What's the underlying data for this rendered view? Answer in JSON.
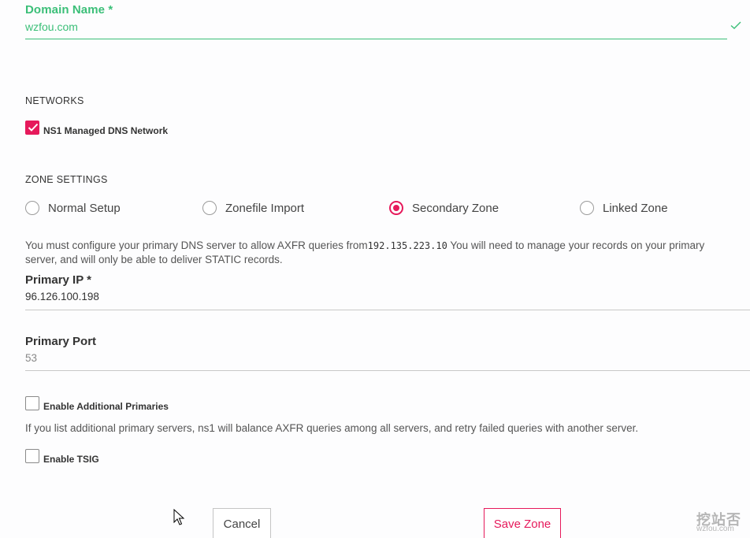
{
  "domain": {
    "label": "Domain Name *",
    "value": "wzfou.com"
  },
  "networks": {
    "heading": "NETWORKS",
    "ns1": {
      "label": "NS1 Managed DNS Network",
      "checked": true
    }
  },
  "zone_settings": {
    "heading": "ZONE SETTINGS",
    "options": [
      {
        "label": "Normal Setup",
        "selected": false
      },
      {
        "label": "Zonefile Import",
        "selected": false
      },
      {
        "label": "Secondary Zone",
        "selected": true
      },
      {
        "label": "Linked Zone",
        "selected": false
      }
    ],
    "help_before": "You must configure your primary DNS server to allow AXFR queries from",
    "help_ip": "192.135.223.10",
    "help_after_line1": " You will need to manage your records on your primary",
    "help_line2": "server, and will only be able to deliver STATIC records."
  },
  "primary_ip": {
    "label": "Primary IP *",
    "value": "96.126.100.198"
  },
  "primary_port": {
    "label": "Primary Port",
    "placeholder": "53"
  },
  "additional_primaries": {
    "label": "Enable Additional Primaries",
    "checked": false,
    "help": "If you list additional primary servers, ns1 will balance AXFR queries among all servers, and retry failed queries with another server."
  },
  "tsig": {
    "label": "Enable TSIG",
    "checked": false
  },
  "buttons": {
    "cancel": "Cancel",
    "save": "Save Zone"
  },
  "watermark": {
    "text": "挖站否",
    "url": "wzfou.com"
  },
  "colors": {
    "accent": "#e6195b",
    "valid": "#3bbf78"
  }
}
